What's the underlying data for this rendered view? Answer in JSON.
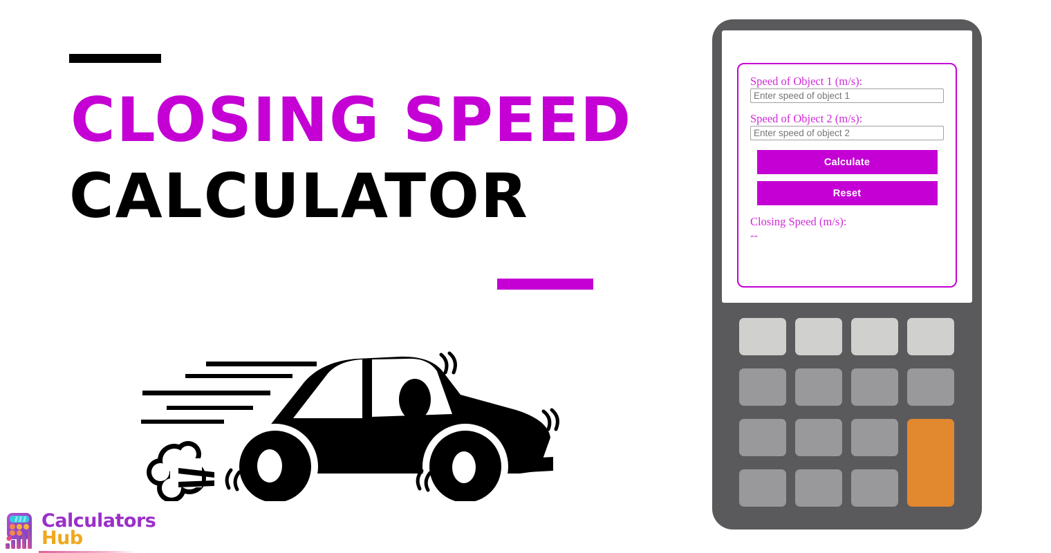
{
  "page": {
    "background_color": "#ffffff",
    "accent_color": "#c400d4",
    "black": "#000000"
  },
  "promo": {
    "headline_line_1": "CLOSING SPEED",
    "headline_line_2": "CALCULATOR",
    "accent_bar_top_color": "#000000",
    "accent_bar_bottom_color": "#c400d4",
    "illustration": "speeding-car-icon"
  },
  "logo": {
    "word_1": "Calculators",
    "word_2": "Hub",
    "word_1_color": "#9b30c8",
    "word_2_color": "#f0a81e",
    "mark": "calculator-bar-chart-logo-icon"
  },
  "calculator": {
    "device_color": "#5a5a5c",
    "screen_color": "#ffffff",
    "card_border_color": "#c400d4",
    "form": {
      "fields": [
        {
          "label": "Speed of Object 1 (m/s):",
          "placeholder": "Enter speed of object 1",
          "value": ""
        },
        {
          "label": "Speed of Object 2 (m/s):",
          "placeholder": "Enter speed of object 2",
          "value": ""
        }
      ],
      "calculate_label": "Calculate",
      "reset_label": "Reset",
      "button_color": "#c400d4"
    },
    "result": {
      "label": "Closing Speed (m/s):",
      "value": "--"
    },
    "keypad": {
      "rows": 4,
      "columns": 4,
      "light_key_color": "#d0d0cf",
      "mid_key_color": "#99999b",
      "accent_key_color": "#e2882f",
      "keys": [
        {
          "name": "key-r1c1",
          "style": "light"
        },
        {
          "name": "key-r1c2",
          "style": "light"
        },
        {
          "name": "key-r1c3",
          "style": "light"
        },
        {
          "name": "key-r1c4",
          "style": "light"
        },
        {
          "name": "key-r2c1",
          "style": "mid"
        },
        {
          "name": "key-r2c2",
          "style": "mid"
        },
        {
          "name": "key-r2c3",
          "style": "mid"
        },
        {
          "name": "key-r2c4",
          "style": "mid"
        },
        {
          "name": "key-r3c1",
          "style": "mid"
        },
        {
          "name": "key-r3c2",
          "style": "mid"
        },
        {
          "name": "key-r3c3",
          "style": "mid"
        },
        {
          "name": "key-r4c1",
          "style": "mid"
        },
        {
          "name": "key-r4c2",
          "style": "mid"
        },
        {
          "name": "key-r4c3",
          "style": "mid"
        },
        {
          "name": "key-accent-tall",
          "style": "accent"
        }
      ]
    }
  }
}
